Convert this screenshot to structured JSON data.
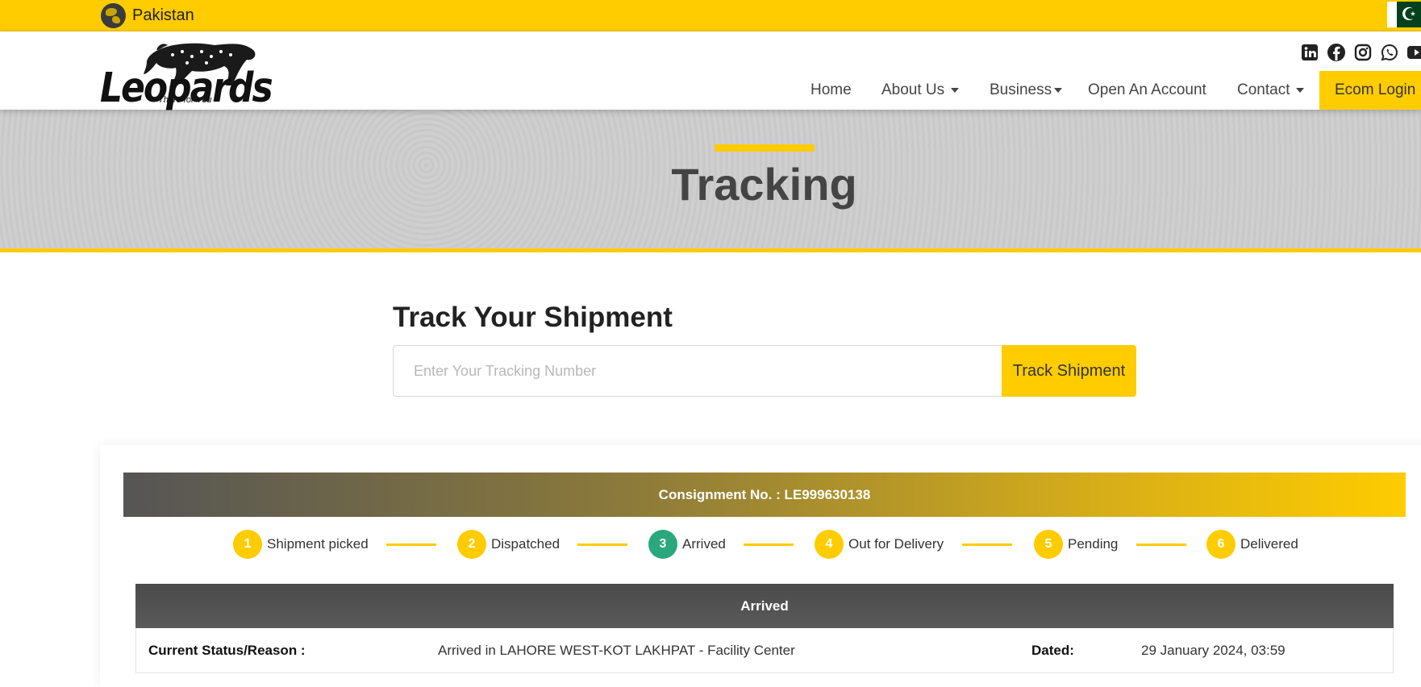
{
  "topbar": {
    "country": "Pakistan",
    "flag_icon": "pakistan-flag-icon",
    "accent": "#ffcc00"
  },
  "header": {
    "logo_text": "Leopards",
    "logo_tagline": "There for You",
    "social_icons": [
      "linkedin-icon",
      "facebook-icon",
      "instagram-icon",
      "whatsapp-icon",
      "youtube-icon"
    ],
    "nav": [
      {
        "label": "Home",
        "dropdown": false
      },
      {
        "label": "About Us",
        "dropdown": true
      },
      {
        "label": "Business",
        "dropdown": true
      },
      {
        "label": "Open An Account",
        "dropdown": false
      },
      {
        "label": "Contact",
        "dropdown": true
      }
    ],
    "login_label": "Ecom Login"
  },
  "banner": {
    "title": "Tracking"
  },
  "tracker": {
    "title": "Track Your Shipment",
    "placeholder": "Enter Your Tracking Number",
    "button_label": "Track Shipment"
  },
  "result": {
    "consignment": "Consignment No. : LE999630138",
    "steps": [
      {
        "num": "1",
        "label": "Shipment picked",
        "active": false
      },
      {
        "num": "2",
        "label": "Dispatched",
        "active": false
      },
      {
        "num": "3",
        "label": "Arrived",
        "active": true
      },
      {
        "num": "4",
        "label": "Out for Delivery",
        "active": false
      },
      {
        "num": "5",
        "label": "Pending",
        "active": false
      },
      {
        "num": "6",
        "label": "Delivered",
        "active": false
      }
    ],
    "status_heading": "Arrived",
    "status_label": "Current Status/Reason :",
    "status_value": "Arrived in LAHORE WEST-KOT LAKHPAT - Facility Center",
    "dated_label": "Dated:",
    "dated_value": "29 January 2024, 03:59",
    "active_color": "#2aa77d"
  }
}
